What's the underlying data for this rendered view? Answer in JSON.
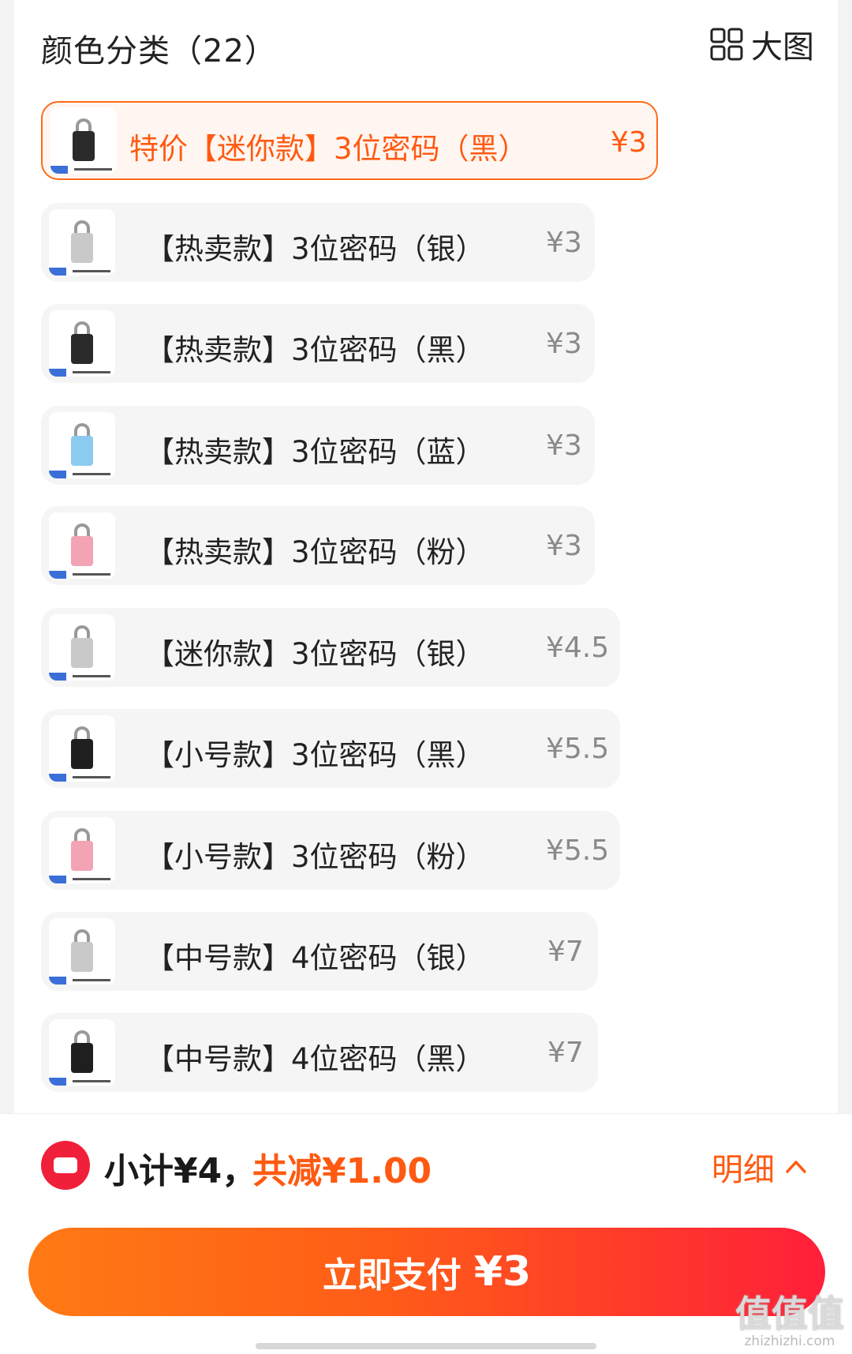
{
  "header": {
    "title": "颜色分类（22）",
    "big_image_label": "大图",
    "big_image_icon": "grid-icon"
  },
  "skus": [
    {
      "name": "特价【迷你款】3位密码（黑）",
      "price": "¥3",
      "selected": true,
      "lock_color": "#2a2a2a"
    },
    {
      "name": "【热卖款】3位密码（银）",
      "price": "¥3",
      "selected": false,
      "lock_color": "#c9c9c9"
    },
    {
      "name": "【热卖款】3位密码（黑）",
      "price": "¥3",
      "selected": false,
      "lock_color": "#2a2a2a"
    },
    {
      "name": "【热卖款】3位密码（蓝）",
      "price": "¥3",
      "selected": false,
      "lock_color": "#8ccbf0"
    },
    {
      "name": "【热卖款】3位密码（粉）",
      "price": "¥3",
      "selected": false,
      "lock_color": "#f2a3b4"
    },
    {
      "name": "【迷你款】3位密码（银）",
      "price": "¥4.5",
      "selected": false,
      "lock_color": "#c9c9c9"
    },
    {
      "name": "【小号款】3位密码（黑）",
      "price": "¥5.5",
      "selected": false,
      "lock_color": "#1f1f1f"
    },
    {
      "name": "【小号款】3位密码（粉）",
      "price": "¥5.5",
      "selected": false,
      "lock_color": "#f2a3b4"
    },
    {
      "name": "【中号款】4位密码（银）",
      "price": "¥7",
      "selected": false,
      "lock_color": "#c9c9c9"
    },
    {
      "name": "【中号款】4位密码（黑）",
      "price": "¥7",
      "selected": false,
      "lock_color": "#1f1f1f"
    }
  ],
  "footer": {
    "coupon_icon": "coupon-icon",
    "subtotal": "小计¥4，",
    "discount": "共减¥1.00",
    "detail_label": "明细",
    "detail_icon": "chevron-up-icon",
    "pay_label": "立即支付",
    "pay_amount": "¥3"
  },
  "watermark": {
    "big": "值值值",
    "small": "zhizhizhi.com"
  },
  "colors": {
    "accent": "#ff5a12",
    "pay_gradient_start": "#ff7a14",
    "pay_gradient_end": "#ff1f3a",
    "coupon_red": "#f0203a"
  }
}
